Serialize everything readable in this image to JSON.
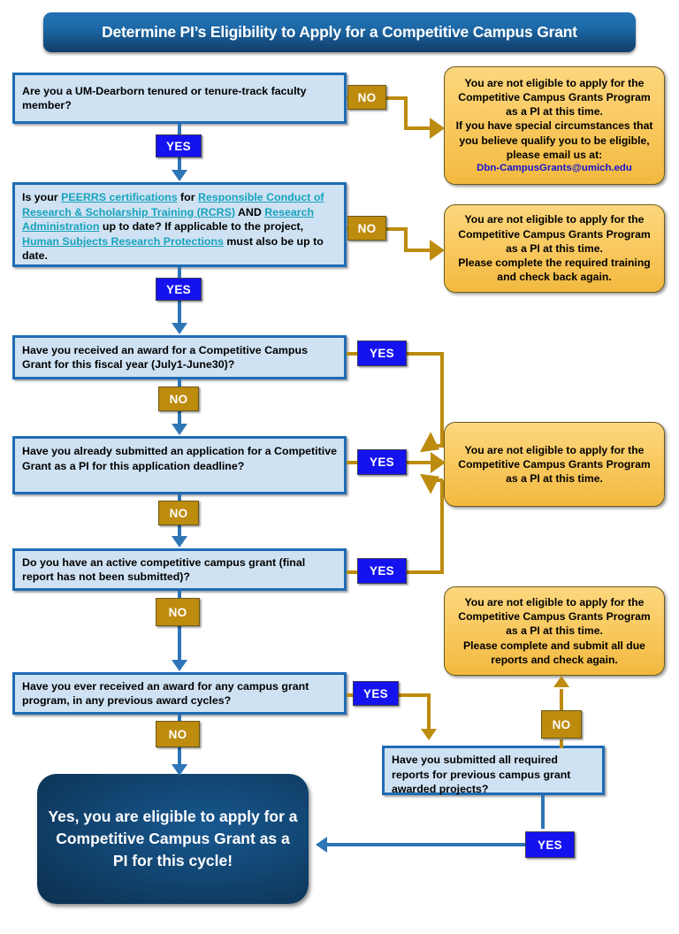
{
  "title": "Determine PI’s Eligibility to Apply for a Competitive Campus Grant",
  "labels": {
    "yes": "YES",
    "no": "NO"
  },
  "colors": {
    "title_blue": "#1d6aa9",
    "question_fill": "#cfe2f3",
    "question_border": "#1f6cb4",
    "result_yellow": "#f9ca62",
    "gold": "#bd8b0d",
    "yes_blue": "#1512f0",
    "link_teal": "#18a3bd",
    "arrow_blue": "#2e75b6",
    "final_navy": "#124673",
    "email_blue": "#1414d2"
  },
  "questions": [
    {
      "id": "q1",
      "text": "Are you a UM-Dearborn tenured or tenure-track faculty member?"
    },
    {
      "id": "q2",
      "segments": [
        {
          "t": "Is your ",
          "link": false
        },
        {
          "t": "PEERRS certifications",
          "link": true
        },
        {
          "t": " for ",
          "link": false
        },
        {
          "t": "Responsible Conduct of Research & Scholarship Training (RCRS)",
          "link": true
        },
        {
          "t": " AND ",
          "link": false
        },
        {
          "t": "Research Administration",
          "link": true
        },
        {
          "t": " up to date? If applicable to the project, ",
          "link": false
        },
        {
          "t": "Human Subjects Research Protections",
          "link": true
        },
        {
          "t": " must also be up to date.",
          "link": false
        }
      ]
    },
    {
      "id": "q3",
      "text": "Have you received an award for a Competitive Campus Grant for this fiscal year (July1-June30)?"
    },
    {
      "id": "q4",
      "text": "Have you already submitted an application for a Competitive Grant as a PI for this application deadline?"
    },
    {
      "id": "q5",
      "text": "Do you have an active competitive campus grant (final report has not been submitted)?"
    },
    {
      "id": "q6",
      "text": "Have you ever received an award for any campus grant program, in any previous award cycles?"
    },
    {
      "id": "q7",
      "text": "Have you submitted all required reports for previous campus grant awarded projects?"
    }
  ],
  "results": [
    {
      "id": "r1",
      "line1": "You are not eligible to apply for the Competitive Campus Grants Program as a PI at this time.",
      "line2": "If you have special circumstances that you believe qualify you to be eligible, please email us at:",
      "email": "Dbn-CampusGrants@umich.edu"
    },
    {
      "id": "r2",
      "line1": "You are not eligible to apply for the Competitive Campus Grants Program as a PI at this time.",
      "line2": "Please complete the required training and check back again."
    },
    {
      "id": "r3",
      "line1": "You are not eligible to apply for the Competitive Campus Grants Program as a PI at this time."
    },
    {
      "id": "r4",
      "line1": "You are not eligible to apply for the Competitive Campus Grants Program as a PI at this time.",
      "line2": "Please complete and submit  all due reports and check again."
    }
  ],
  "final": "Yes, you are eligible to apply for a Competitive Campus Grant as a PI for this cycle!"
}
